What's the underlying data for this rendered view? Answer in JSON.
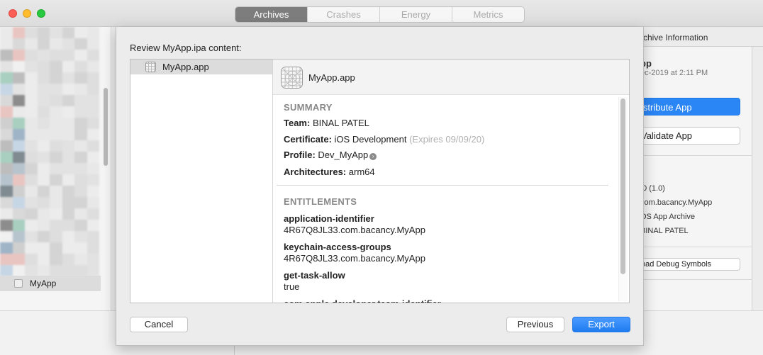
{
  "window": {
    "tabs": [
      {
        "label": "Archives",
        "active": true
      },
      {
        "label": "Crashes",
        "active": false
      },
      {
        "label": "Energy",
        "active": false
      },
      {
        "label": "Metrics",
        "active": false
      }
    ]
  },
  "sidebar": {
    "selected_item": "MyApp"
  },
  "inspector": {
    "header": "rchive Information",
    "app_name": "pp",
    "date": "ec-2019 at 2:11 PM",
    "distribute_label": "istribute App",
    "validate_label": "Validate App",
    "details": [
      ".0 (1.0)",
      "com.bacancy.MyApp",
      "OS App Archive",
      "BINAL PATEL"
    ],
    "debug_symbols_label": "oad Debug Symbols"
  },
  "sheet": {
    "title": "Review MyApp.ipa content:",
    "file_list": [
      {
        "label": "MyApp.app",
        "icon": "app-icon",
        "selected": true
      }
    ],
    "detail": {
      "name": "MyApp.app",
      "summary": {
        "heading": "SUMMARY",
        "team_label": "Team:",
        "team_value": "BINAL PATEL",
        "certificate_label": "Certificate:",
        "certificate_value": "iOS Development",
        "certificate_expiry": "(Expires 09/09/20)",
        "profile_label": "Profile:",
        "profile_value": "Dev_MyApp",
        "architectures_label": "Architectures:",
        "architectures_value": "arm64"
      },
      "entitlements": {
        "heading": "ENTITLEMENTS",
        "items": [
          {
            "key": "application-identifier",
            "value": "4R67Q8JL33.com.bacancy.MyApp"
          },
          {
            "key": "keychain-access-groups",
            "value": "4R67Q8JL33.com.bacancy.MyApp"
          },
          {
            "key": "get-task-allow",
            "value": "true"
          },
          {
            "key": "com.apple.developer.team-identifier",
            "value": ""
          }
        ]
      }
    },
    "buttons": {
      "cancel": "Cancel",
      "previous": "Previous",
      "export": "Export"
    }
  },
  "colors": {
    "accent": "#2b86f5",
    "segment_active": "#7d7d7d"
  }
}
